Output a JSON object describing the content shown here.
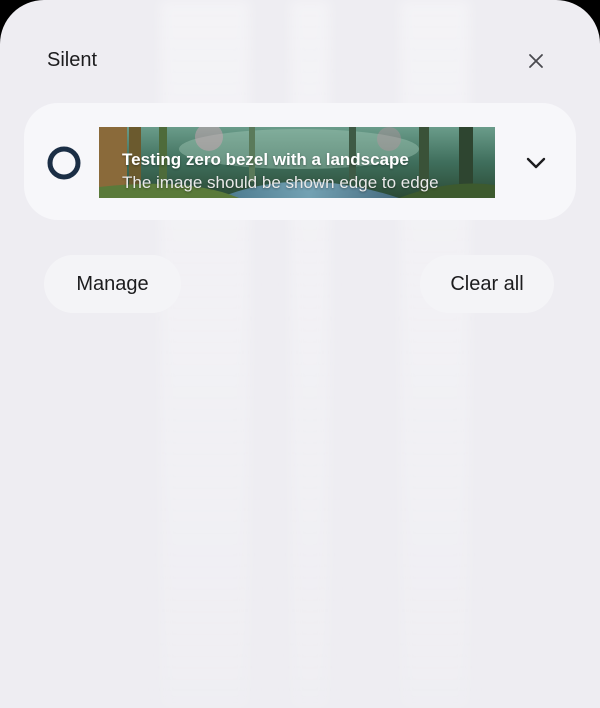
{
  "section": {
    "title": "Silent",
    "close_icon": "close-icon"
  },
  "notification": {
    "app_icon": "ring-icon",
    "title": "Testing zero bezel with a landscape",
    "text": "The image should be shown edge to edge",
    "expand_icon": "chevron-down-icon"
  },
  "actions": {
    "manage_label": "Manage",
    "clear_all_label": "Clear all"
  },
  "colors": {
    "sheet_background": "#eeedf2",
    "card_background": "#f7f7fa",
    "app_icon_color": "#1b2e45",
    "text_primary": "#1c1c1e"
  }
}
